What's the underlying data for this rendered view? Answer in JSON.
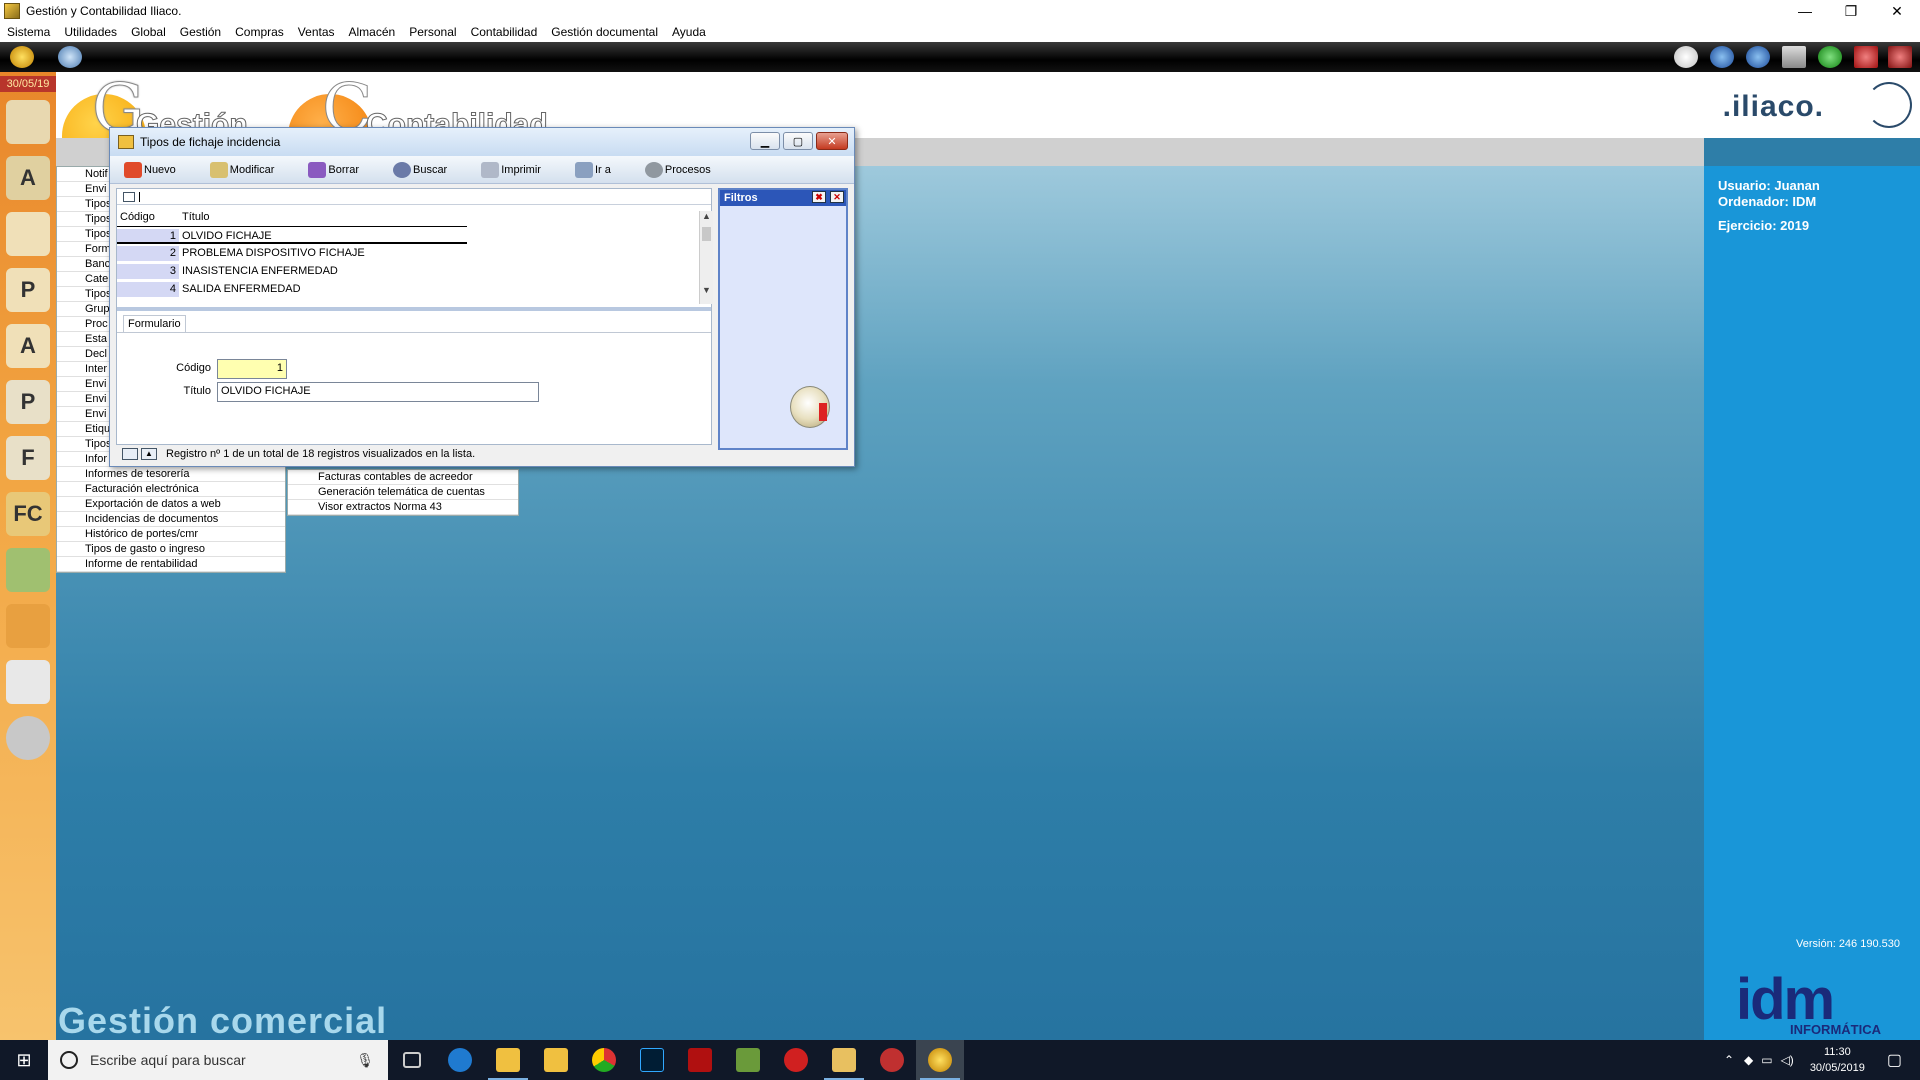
{
  "window": {
    "title": "Gestión y Contabilidad Iliaco.",
    "controls": [
      "—",
      "❐",
      "✕"
    ]
  },
  "menubar": [
    "Sistema",
    "Utilidades",
    "Global",
    "Gestión",
    "Compras",
    "Ventas",
    "Almacén",
    "Personal",
    "Contabilidad",
    "Gestión documental",
    "Ayuda"
  ],
  "sidebar": {
    "date": "30/05/19"
  },
  "header": {
    "g_letter": "G",
    "word1": "Gestión",
    "c_letter": "C",
    "word2": "Contabilidad",
    "logo": ".iliaco."
  },
  "right_panel": {
    "user": "Usuario: Juanan",
    "computer": "Ordenador: IDM",
    "year": "Ejercicio: 2019",
    "version": "Versión: 246 190.530",
    "company_logo": "idm",
    "company_sub": "INFORMÁTICA"
  },
  "background_label": "Gestión comercial",
  "menu_col1_partial": [
    "Notif",
    "Envi",
    "Tipos",
    "Tipos",
    "Tipos",
    "Form",
    "Banc",
    "Cate",
    "Tipos",
    "Grup",
    "Proc",
    "Esta",
    "Decl",
    "Inter",
    "Envi",
    "Envi",
    "Envi",
    "Etiqu",
    "Tipos",
    "Infor"
  ],
  "menu_col1": [
    "Informes de tesorería",
    "Facturación electrónica",
    "Exportación de datos a web",
    "Incidencias de documentos",
    "Histórico de portes/cmr",
    "Tipos de gasto o ingreso",
    "Informe de rentabilidad"
  ],
  "menu_col2": [
    "Facturas contables de acreedor",
    "Generación telemática de cuentas",
    "Visor extractos Norma 43"
  ],
  "modal": {
    "title": "Tipos de fichaje incidencia",
    "toolbar": [
      {
        "label": "Nuevo",
        "color": "#e04a2a"
      },
      {
        "label": "Modificar",
        "color": "#d8c070"
      },
      {
        "label": "Borrar",
        "color": "#8a5ac0"
      },
      {
        "label": "Buscar",
        "color": "#6a7aa8"
      },
      {
        "label": "Imprimir",
        "color": "#b0b8c8"
      },
      {
        "label": "Ir a",
        "color": "#8aa0c0"
      },
      {
        "label": "Procesos",
        "color": "#9098a0"
      }
    ],
    "grid": {
      "headers": [
        "Código",
        "Título"
      ],
      "rows": [
        {
          "code": "1",
          "title": "OLVIDO FICHAJE"
        },
        {
          "code": "2",
          "title": "PROBLEMA DISPOSITIVO FICHAJE"
        },
        {
          "code": "3",
          "title": "INASISTENCIA ENFERMEDAD"
        },
        {
          "code": "4",
          "title": "SALIDA ENFERMEDAD"
        }
      ]
    },
    "tab": "Formulario",
    "form": {
      "code_label": "Código",
      "code_value": "1",
      "title_label": "Título",
      "title_value": "OLVIDO FICHAJE"
    },
    "status": "Registro nº 1 de un total de 18 registros visualizados en la lista.",
    "filters_title": "Filtros"
  },
  "taskbar": {
    "search_placeholder": "Escribe aquí para buscar",
    "time": "11:30",
    "date": "30/05/2019"
  }
}
